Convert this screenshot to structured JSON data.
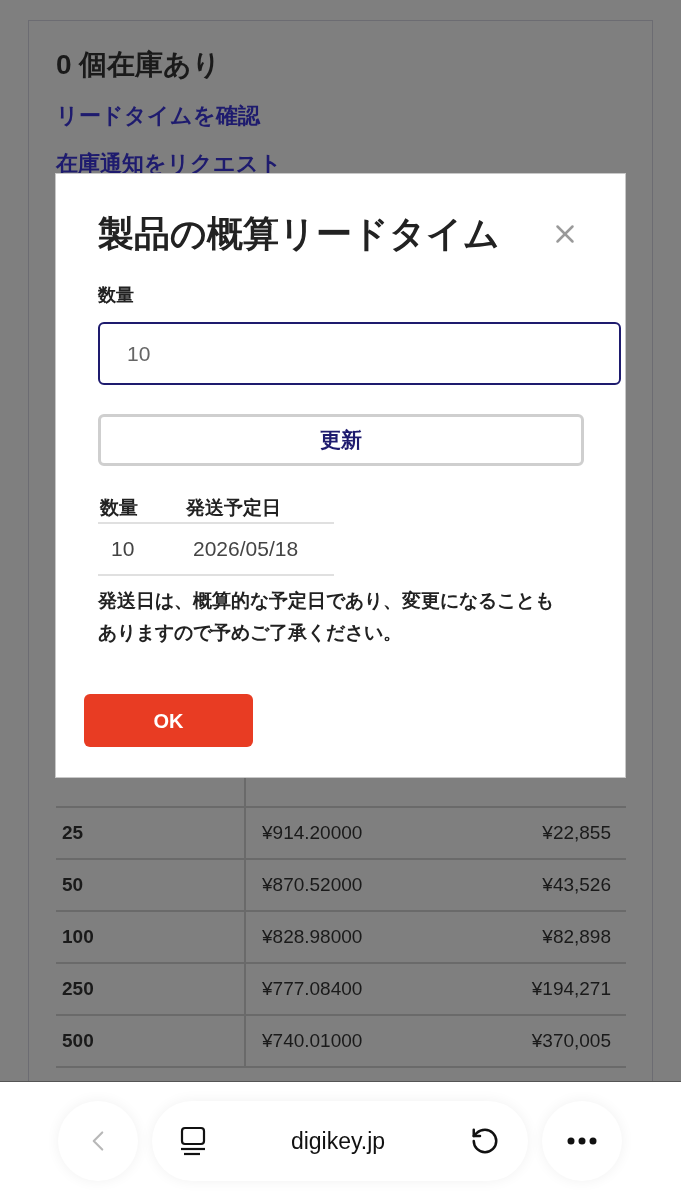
{
  "page": {
    "stock_heading": "0 個在庫あり",
    "links": [
      "リードタイムを確認",
      "在庫通知をリクエスト"
    ],
    "price_table": {
      "rows": [
        {
          "quantity": "25",
          "unit_price": "¥914.20000",
          "total": "¥22,855"
        },
        {
          "quantity": "50",
          "unit_price": "¥870.52000",
          "total": "¥43,526"
        },
        {
          "quantity": "100",
          "unit_price": "¥828.98000",
          "total": "¥82,898"
        },
        {
          "quantity": "250",
          "unit_price": "¥777.08400",
          "total": "¥194,271"
        },
        {
          "quantity": "500",
          "unit_price": "¥740.01000",
          "total": "¥370,005"
        }
      ]
    }
  },
  "dialog": {
    "title": "製品の概算リードタイム",
    "quantity_label": "数量",
    "quantity_input": {
      "value": "10"
    },
    "update_button": "更新",
    "lead_time_table": {
      "columns": [
        "数量",
        "発送予定日"
      ],
      "rows": [
        {
          "quantity": "10",
          "ship_date": "2026/05/18"
        }
      ]
    },
    "note": "発送日は、概算的な予定日であり、変更になることもありますので予めご了承ください。",
    "ok_button": "OK"
  },
  "browser_bar": {
    "back_button": {
      "disabled": true
    },
    "url": "digikey.jp"
  }
}
